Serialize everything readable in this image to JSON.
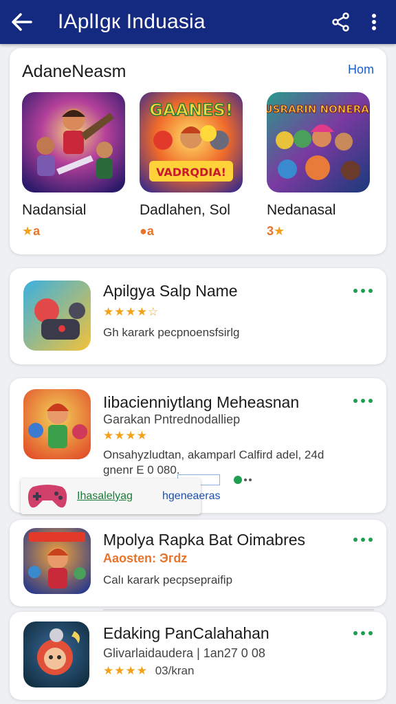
{
  "appbar": {
    "title": "IAplIgк Induasia",
    "icons": [
      "back-arrow-icon",
      "share-icon",
      "more-vert-icon"
    ]
  },
  "featured": {
    "title": "AdaneNeasm",
    "link": "Hom",
    "items": [
      {
        "name": "Nadansial",
        "rating": "★",
        "rating_suffix": "a"
      },
      {
        "name": "Dadlahen, Sol",
        "rating": "●",
        "rating_suffix": "a"
      },
      {
        "name": "Nedanasal",
        "rating": "3",
        "rating_suffix": "★"
      }
    ],
    "thumb_texts": [
      "GAANES!",
      "VADRQDIA!",
      "RUSRARIN NONERAL!"
    ]
  },
  "apps": [
    {
      "name": "Apilgya Salp Name",
      "stars": "★★★★☆",
      "desc": "Gh karark pecpnoensfsirlg"
    },
    {
      "name": "Iibacienniytlang Meheasnan",
      "sub": "Garakan Pntrednodalliep",
      "stars": "★★★★",
      "desc1": "Onsahyzludtan, akamparl Calfird adel, 24d",
      "desc2": "gnenr  E 0 080."
    },
    {
      "name": "Mpolya Rapka Bat Oimabres",
      "sub": "Aaosten: Эгdz",
      "desc": "Calı karark pecpsepraifip"
    },
    {
      "name": "Edaking PanCalahahan",
      "sub": "Glivarlaidaudera | 1an27 0 08",
      "stars": "★★★★",
      "stars_suffix": "03/kran"
    }
  ],
  "chip": {
    "label1": "Ihasalelyag",
    "label2": "hgeneaeras"
  },
  "colors": {
    "appbar": "#142a80",
    "accent_green": "#1e9e50",
    "star": "#f2a118",
    "link": "#1a5ec8"
  }
}
